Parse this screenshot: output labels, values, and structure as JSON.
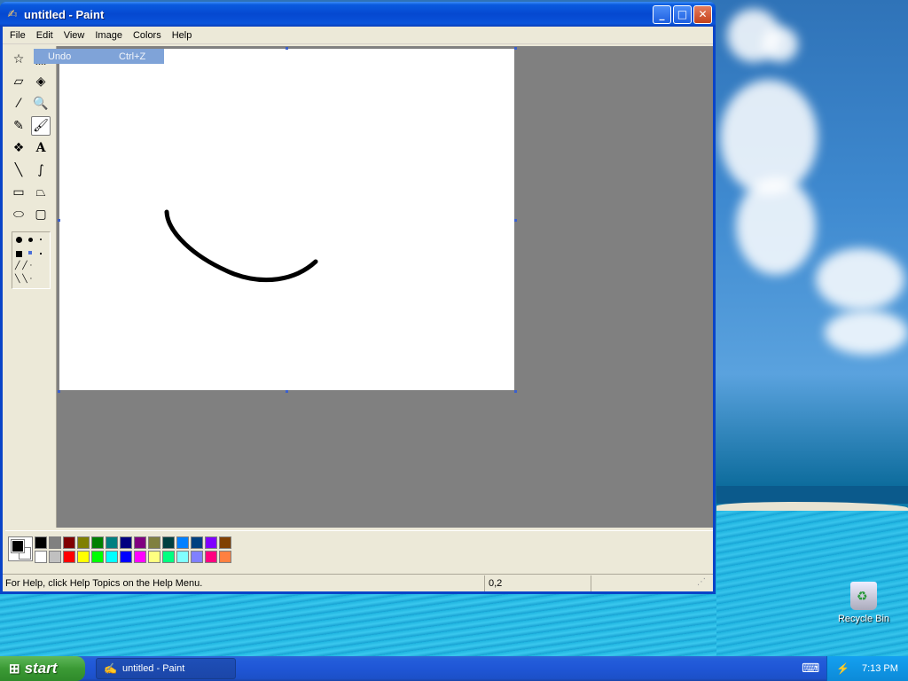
{
  "window": {
    "title": "untitled - Paint",
    "controls": {
      "minimize": "_",
      "maximize": "□",
      "close": "✕"
    }
  },
  "menubar": [
    "File",
    "Edit",
    "View",
    "Image",
    "Colors",
    "Help"
  ],
  "edit_menu_item": {
    "label": "Undo",
    "shortcut": "Ctrl+Z"
  },
  "tools": [
    {
      "name": "free-form-select-icon",
      "glyph": "☆"
    },
    {
      "name": "select-icon",
      "glyph": "⬚"
    },
    {
      "name": "eraser-icon",
      "glyph": "▱"
    },
    {
      "name": "fill-bucket-icon",
      "glyph": "◈"
    },
    {
      "name": "pick-color-icon",
      "glyph": "⁄"
    },
    {
      "name": "magnifier-icon",
      "glyph": "🔍"
    },
    {
      "name": "pencil-icon",
      "glyph": "✎"
    },
    {
      "name": "brush-icon",
      "glyph": "🖌"
    },
    {
      "name": "airbrush-icon",
      "glyph": "❖"
    },
    {
      "name": "text-icon",
      "glyph": "A"
    },
    {
      "name": "line-icon",
      "glyph": "╲"
    },
    {
      "name": "curve-icon",
      "glyph": "∫"
    },
    {
      "name": "rectangle-icon",
      "glyph": "▭"
    },
    {
      "name": "polygon-icon",
      "glyph": "⏢"
    },
    {
      "name": "ellipse-icon",
      "glyph": "⬭"
    },
    {
      "name": "rounded-rectangle-icon",
      "glyph": "▢"
    }
  ],
  "selected_tool": "brush-icon",
  "palette": {
    "foreground": "#000000",
    "background": "#ffffff",
    "row1": [
      "#000000",
      "#808080",
      "#800000",
      "#808000",
      "#008000",
      "#008080",
      "#000080",
      "#800080",
      "#808040",
      "#004040",
      "#0080ff",
      "#004080",
      "#8000ff",
      "#804000"
    ],
    "row2": [
      "#ffffff",
      "#c0c0c0",
      "#ff0000",
      "#ffff00",
      "#00ff00",
      "#00ffff",
      "#0000ff",
      "#ff00ff",
      "#ffff80",
      "#00ff80",
      "#80ffff",
      "#8080ff",
      "#ff0080",
      "#ff8040"
    ]
  },
  "statusbar": {
    "help_text": "For Help, click Help Topics on the Help Menu.",
    "coords": "0,2"
  },
  "desktop": {
    "recycle_bin_label": "Recycle Bin"
  },
  "taskbar": {
    "start_label": "start",
    "task_label": "untitled - Paint",
    "clock": "7:13 PM"
  }
}
